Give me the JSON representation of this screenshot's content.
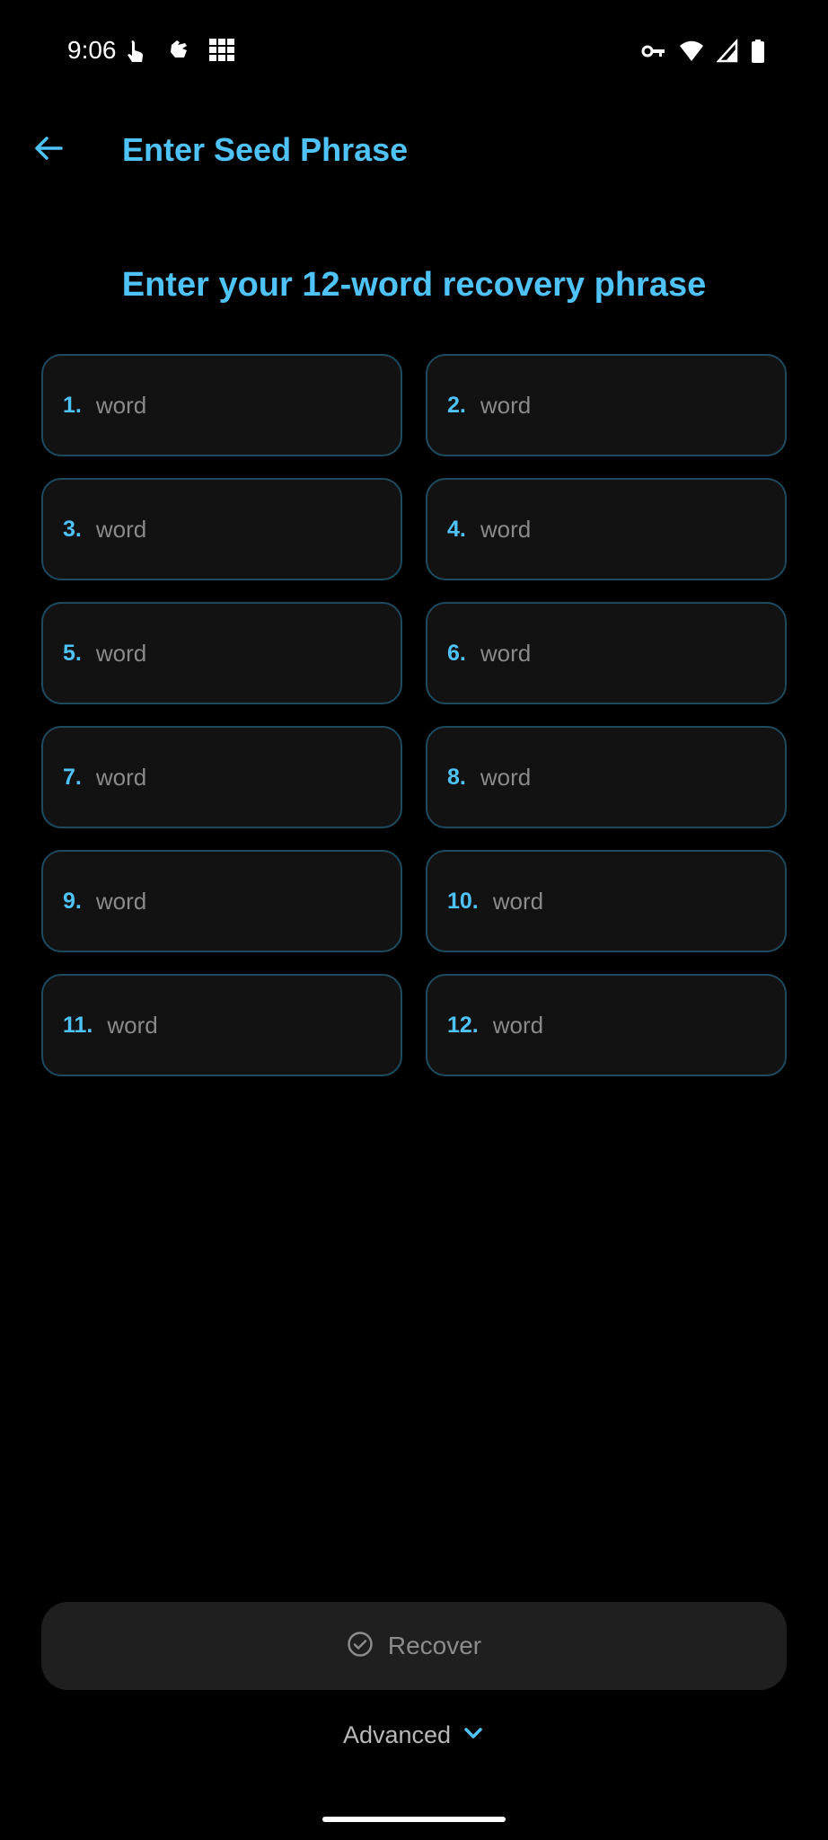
{
  "status_bar": {
    "time": "9:06",
    "left_icons": [
      "touch-icon",
      "hand-icon",
      "grid-icon"
    ],
    "right_icons": [
      "vpn-key-icon",
      "wifi-icon",
      "signal-icon",
      "battery-icon"
    ]
  },
  "app_bar": {
    "title": "Enter Seed Phrase"
  },
  "heading": "Enter your 12-word recovery phrase",
  "words": [
    {
      "number": "1.",
      "placeholder": "word"
    },
    {
      "number": "2.",
      "placeholder": "word"
    },
    {
      "number": "3.",
      "placeholder": "word"
    },
    {
      "number": "4.",
      "placeholder": "word"
    },
    {
      "number": "5.",
      "placeholder": "word"
    },
    {
      "number": "6.",
      "placeholder": "word"
    },
    {
      "number": "7.",
      "placeholder": "word"
    },
    {
      "number": "8.",
      "placeholder": "word"
    },
    {
      "number": "9.",
      "placeholder": "word"
    },
    {
      "number": "10.",
      "placeholder": "word"
    },
    {
      "number": "11.",
      "placeholder": "word"
    },
    {
      "number": "12.",
      "placeholder": "word"
    }
  ],
  "recover_button": {
    "label": "Recover",
    "icon": "check-circle-icon"
  },
  "advanced": {
    "label": "Advanced",
    "icon": "chevron-down-icon"
  },
  "colors": {
    "accent": "#4fc3f7",
    "background": "#000000",
    "field_border": "#1e4a5f",
    "field_bg": "#121212",
    "button_bg": "#1f1f1f"
  }
}
